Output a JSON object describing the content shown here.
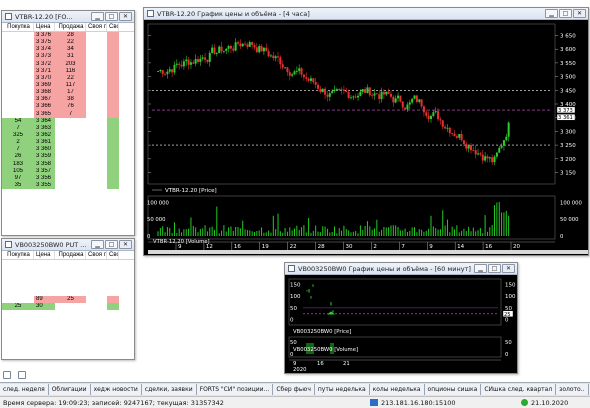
{
  "orderbook_top": {
    "title": "VTBR-12.20 [FO...",
    "headers": [
      "Покупка",
      "Цена",
      "Продажа",
      "Своя пок.",
      "Своя пр."
    ],
    "rows": [
      {
        "buy": "",
        "price": "3 376",
        "sell": "28",
        "side": "ask"
      },
      {
        "buy": "",
        "price": "3 375",
        "sell": "22",
        "side": "ask"
      },
      {
        "buy": "",
        "price": "3 374",
        "sell": "34",
        "side": "ask"
      },
      {
        "buy": "",
        "price": "3 373",
        "sell": "31",
        "side": "ask"
      },
      {
        "buy": "",
        "price": "3 372",
        "sell": "203",
        "side": "ask"
      },
      {
        "buy": "",
        "price": "3 371",
        "sell": "116",
        "side": "ask"
      },
      {
        "buy": "",
        "price": "3 370",
        "sell": "22",
        "side": "ask"
      },
      {
        "buy": "",
        "price": "3 369",
        "sell": "117",
        "side": "ask"
      },
      {
        "buy": "",
        "price": "3 368",
        "sell": "17",
        "side": "ask"
      },
      {
        "buy": "",
        "price": "3 367",
        "sell": "38",
        "side": "ask"
      },
      {
        "buy": "",
        "price": "3 366",
        "sell": "76",
        "side": "ask"
      },
      {
        "buy": "",
        "price": "3 365",
        "sell": "7",
        "side": "ask"
      },
      {
        "buy": "54",
        "price": "3 364",
        "sell": "",
        "side": "bid"
      },
      {
        "buy": "7",
        "price": "3 363",
        "sell": "",
        "side": "bid"
      },
      {
        "buy": "325",
        "price": "3 362",
        "sell": "",
        "side": "bid"
      },
      {
        "buy": "2",
        "price": "3 361",
        "sell": "",
        "side": "bid"
      },
      {
        "buy": "7",
        "price": "3 360",
        "sell": "",
        "side": "bid"
      },
      {
        "buy": "26",
        "price": "3 359",
        "sell": "",
        "side": "bid"
      },
      {
        "buy": "183",
        "price": "3 358",
        "sell": "",
        "side": "bid"
      },
      {
        "buy": "105",
        "price": "3 357",
        "sell": "",
        "side": "bid"
      },
      {
        "buy": "97",
        "price": "3 356",
        "sell": "",
        "side": "bid"
      },
      {
        "buy": "35",
        "price": "3 355",
        "sell": "",
        "side": "bid"
      }
    ]
  },
  "orderbook_bottom": {
    "title": "VB003250BW0 PUT ...",
    "headers": [
      "Покупка",
      "Цена",
      "Продажа",
      "Своя по",
      "Своя пр"
    ],
    "rows": [
      {
        "buy": "",
        "price": "89",
        "sell": "25",
        "side": "ask"
      },
      {
        "buy": "25",
        "price": "30",
        "sell": "",
        "side": "bid"
      }
    ]
  },
  "main_chart": {
    "title": "VTBR-12.20 График цены и объёма - [4 часа]",
    "price_legend": "VTBR-12.20 [Price]",
    "volume_legend": "VTBR-12.20 [Volume]",
    "price_ticks": [
      "3 650",
      "3 600",
      "3 550",
      "3 500",
      "3 450",
      "3 400",
      "3 350",
      "3 300",
      "3 250",
      "3 200",
      "3 150"
    ],
    "price_flags": [
      "3 373",
      "3 361"
    ],
    "volume_ticks": [
      "100 000",
      "50 000",
      "0"
    ],
    "date_ticks": [
      "9",
      "12",
      "16",
      "19",
      "22",
      "28",
      "30",
      "2",
      "7",
      "9",
      "14",
      "16",
      "20"
    ],
    "month_label": "Oct"
  },
  "option_chart": {
    "title": "VB003250BW0 График цены и объёма - [60 минут]",
    "price_legend": "VB003250BW0 [Price]",
    "volume_legend": "VB003250BW0 [Volume]",
    "price_ticks": [
      "150",
      "100",
      "50",
      "0"
    ],
    "price_flag": "25",
    "volume_ticks": [
      "50",
      "0"
    ],
    "date_ticks": [
      "9",
      "16",
      "21"
    ],
    "year_label": "2020"
  },
  "tabs": [
    "след. неделя",
    "Облигации",
    "хедж новости",
    "сделки, заявки",
    "FORTS \"СИ\" позиции...",
    "Сбер фьюч",
    "путы неделька",
    "колы неделька",
    "опционы сишка",
    "СИшка след. квартал",
    "золото..",
    "нефть",
    "опционы рts",
    "втб."
  ],
  "active_tab": "втб.",
  "status": {
    "server_time": "Время сервера: 19:09:23; записей: 9247167; текущая: 31357342",
    "connection": "213.181.16.180:15100",
    "date": "21.10.2020"
  },
  "colors": {
    "ask": "#f5a3a3",
    "bid": "#8fd17c",
    "chart_bg": "#000000"
  }
}
